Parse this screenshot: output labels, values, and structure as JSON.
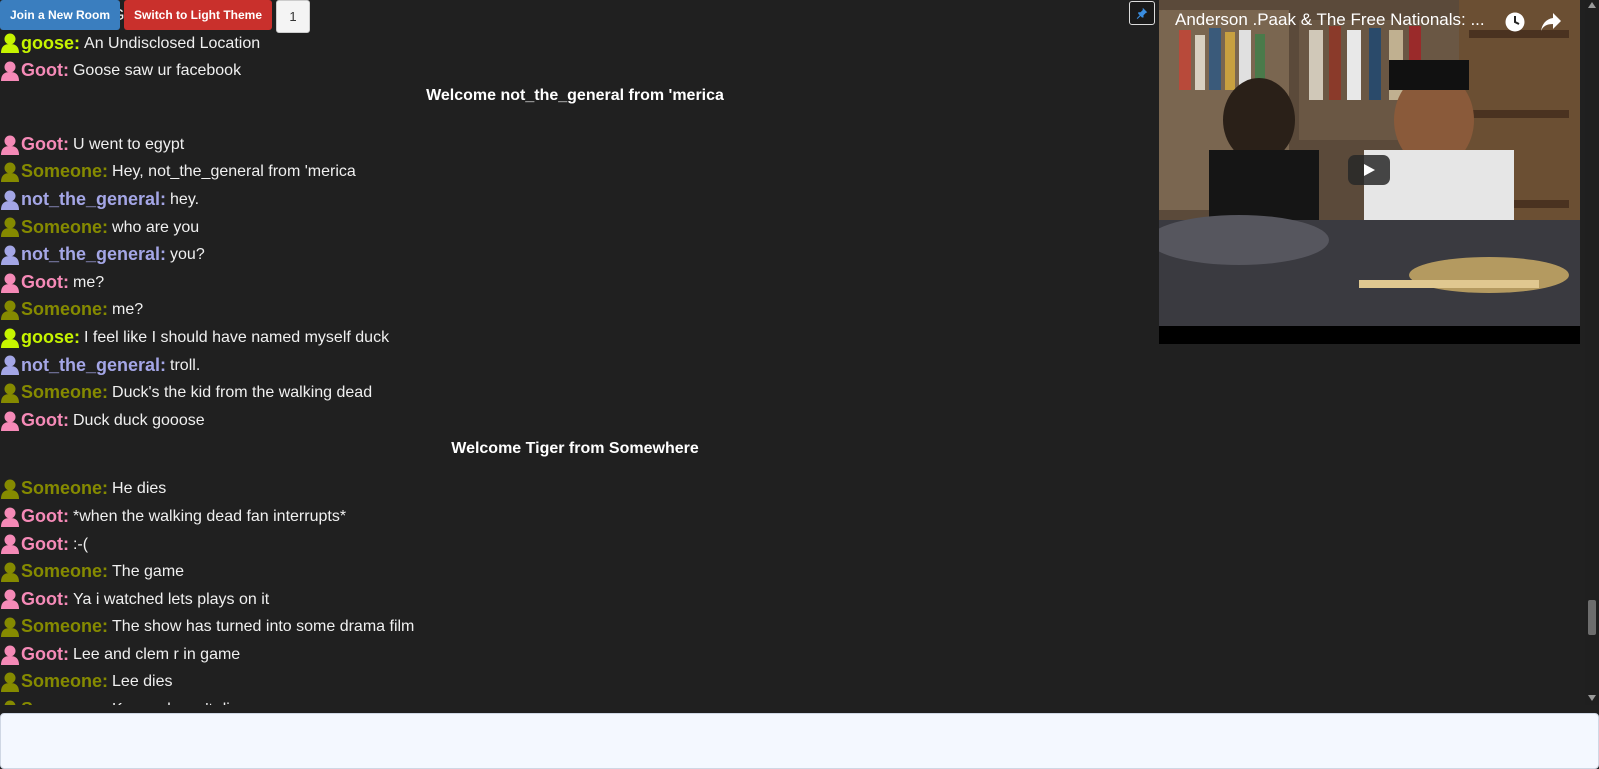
{
  "toolbar": {
    "join_label": "Join a New Room",
    "theme_label": "Switch to Light Theme",
    "count_label": "1"
  },
  "colors": {
    "someone": "#858a00",
    "goose": "#c6f400",
    "goot": "#f58ab7",
    "not_the_general": "#a4a6e6"
  },
  "chat": {
    "top_partial": [
      {
        "user": "Someone:",
        "color": "#858a00",
        "text": "Goot xD"
      }
    ],
    "group1": [
      {
        "user": "goose:",
        "color": "#c6f400",
        "text": "An Undisclosed Location"
      },
      {
        "user": "Goot:",
        "color": "#f58ab7",
        "text": "Goose saw ur facebook"
      }
    ],
    "welcome1": "Welcome not_the_general from 'merica",
    "group2": [
      {
        "user": "Goot:",
        "color": "#f58ab7",
        "text": "U went to egypt"
      },
      {
        "user": "Someone:",
        "color": "#858a00",
        "text": "Hey, not_the_general from 'merica"
      },
      {
        "user": "not_the_general:",
        "color": "#a4a6e6",
        "text": "hey."
      },
      {
        "user": "Someone:",
        "color": "#858a00",
        "text": "who are you"
      },
      {
        "user": "not_the_general:",
        "color": "#a4a6e6",
        "text": "you?"
      },
      {
        "user": "Goot:",
        "color": "#f58ab7",
        "text": "me?"
      },
      {
        "user": "Someone:",
        "color": "#858a00",
        "text": "me?"
      },
      {
        "user": "goose:",
        "color": "#c6f400",
        "text": "I feel like I should have named myself duck"
      },
      {
        "user": "not_the_general:",
        "color": "#a4a6e6",
        "text": "troll."
      },
      {
        "user": "Someone:",
        "color": "#858a00",
        "text": "Duck's the kid from the walking dead"
      },
      {
        "user": "Goot:",
        "color": "#f58ab7",
        "text": "Duck duck gooose"
      }
    ],
    "welcome2": "Welcome Tiger from Somewhere",
    "group3": [
      {
        "user": "Someone:",
        "color": "#858a00",
        "text": "He dies"
      },
      {
        "user": "Goot:",
        "color": "#f58ab7",
        "text": "*when the walking dead fan interrupts*"
      },
      {
        "user": "Goot:",
        "color": "#f58ab7",
        "text": ":-("
      },
      {
        "user": "Someone:",
        "color": "#858a00",
        "text": "The game"
      },
      {
        "user": "Goot:",
        "color": "#f58ab7",
        "text": "Ya i watched lets plays on it"
      },
      {
        "user": "Someone:",
        "color": "#858a00",
        "text": "The show has turned into some drama film"
      },
      {
        "user": "Goot:",
        "color": "#f58ab7",
        "text": "Lee and clem r in game"
      },
      {
        "user": "Someone:",
        "color": "#858a00",
        "text": "Lee dies"
      },
      {
        "user": "Someone:",
        "color": "#858a00",
        "text": "Kenny doesn't die"
      }
    ]
  },
  "video": {
    "title": "Anderson .Paak & The Free Nationals: ...",
    "icons": [
      "clock-icon",
      "share-icon",
      "play-icon",
      "pin-icon"
    ]
  },
  "input": {
    "placeholder": ""
  }
}
